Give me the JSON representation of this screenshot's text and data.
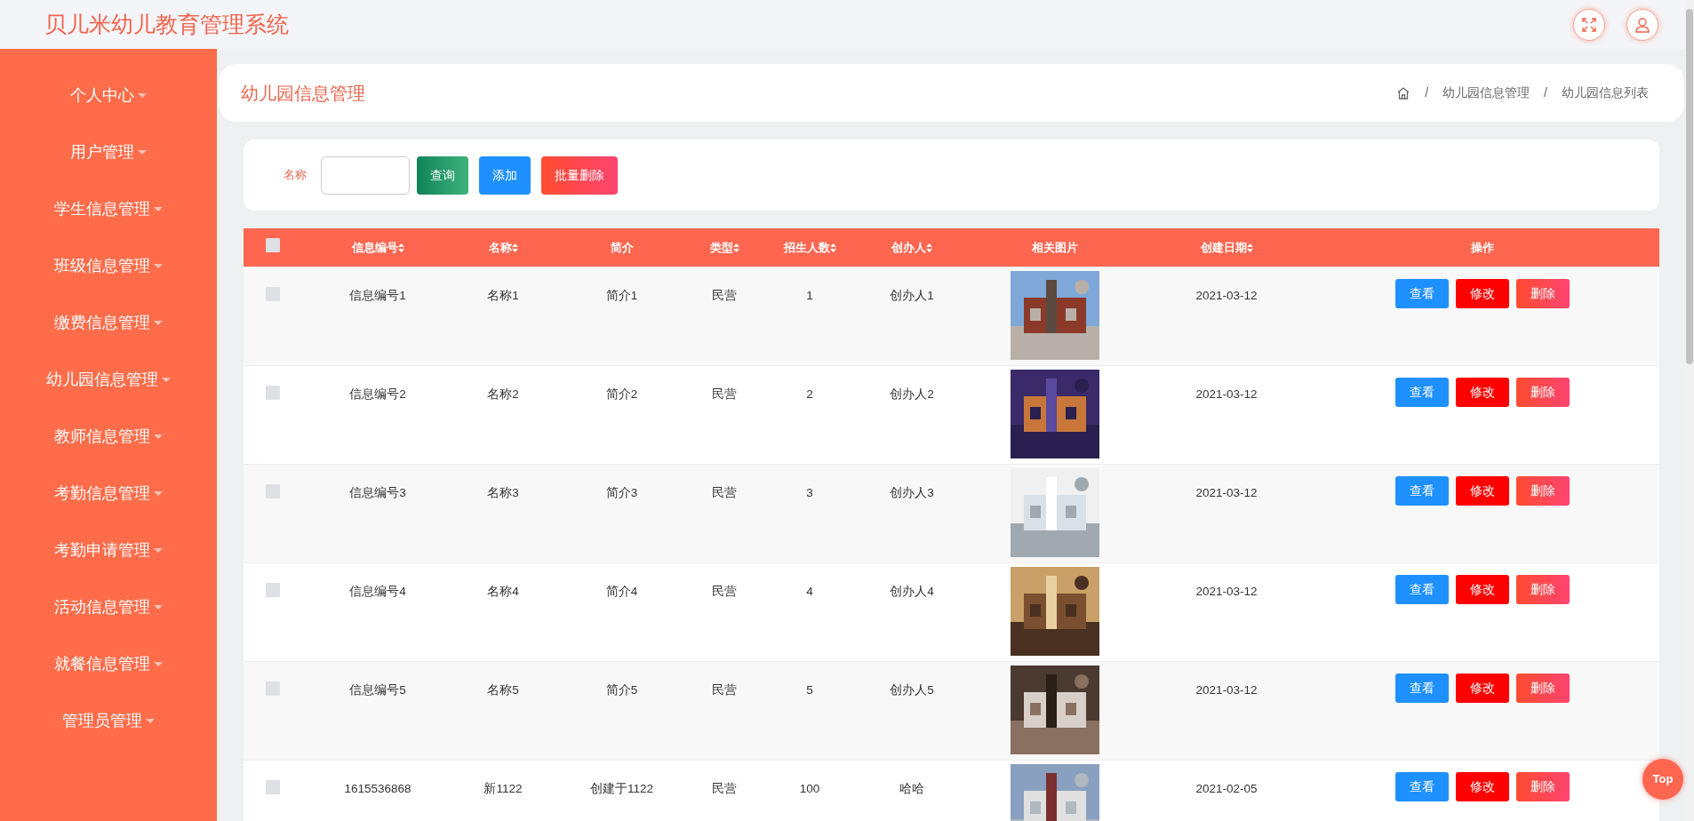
{
  "header": {
    "title": "贝儿米幼儿教育管理系统"
  },
  "sidebar": {
    "items": [
      "个人中心",
      "用户管理",
      "学生信息管理",
      "班级信息管理",
      "缴费信息管理",
      "幼儿园信息管理",
      "教师信息管理",
      "考勤信息管理",
      "考勤申请管理",
      "活动信息管理",
      "就餐信息管理",
      "管理员管理"
    ]
  },
  "page_title": "幼儿园信息管理",
  "breadcrumb": [
    {
      "separator": "/",
      "label": "幼儿园信息管理"
    },
    {
      "separator": "/",
      "label": "幼儿园信息列表"
    }
  ],
  "search": {
    "label": "名称",
    "buttons": [
      {
        "label": "查询",
        "kind": "search"
      },
      {
        "label": "添加",
        "kind": "add"
      },
      {
        "label": "批量删除",
        "kind": "delete"
      }
    ]
  },
  "table": {
    "select_all_checked": false,
    "columns": [
      {
        "label": "信息编号",
        "sortable": true
      },
      {
        "label": "名称",
        "sortable": true
      },
      {
        "label": "简介",
        "sortable": false
      },
      {
        "label": "类型",
        "sortable": true
      },
      {
        "label": "招生人数",
        "sortable": true
      },
      {
        "label": "创办人",
        "sortable": true
      },
      {
        "label": "相关图片",
        "sortable": false
      },
      {
        "label": "创建日期",
        "sortable": true
      },
      {
        "label": "操作",
        "sortable": false
      }
    ],
    "rows": [
      {
        "checked": false,
        "cells": [
          "信息编号1",
          "名称1",
          "简介1",
          "民营",
          "1",
          "创办人1"
        ],
        "date": "2021-03-12",
        "actions": [
          "查看",
          "修改",
          "删除"
        ]
      },
      {
        "checked": false,
        "cells": [
          "信息编号2",
          "名称2",
          "简介2",
          "民营",
          "2",
          "创办人2"
        ],
        "date": "2021-03-12",
        "actions": [
          "查看",
          "修改",
          "删除"
        ]
      },
      {
        "checked": false,
        "cells": [
          "信息编号3",
          "名称3",
          "简介3",
          "民营",
          "3",
          "创办人3"
        ],
        "date": "2021-03-12",
        "actions": [
          "查看",
          "修改",
          "删除"
        ]
      },
      {
        "checked": false,
        "cells": [
          "信息编号4",
          "名称4",
          "简介4",
          "民营",
          "4",
          "创办人4"
        ],
        "date": "2021-03-12",
        "actions": [
          "查看",
          "修改",
          "删除"
        ]
      },
      {
        "checked": false,
        "cells": [
          "信息编号5",
          "名称5",
          "简介5",
          "民营",
          "5",
          "创办人5"
        ],
        "date": "2021-03-12",
        "actions": [
          "查看",
          "修改",
          "删除"
        ]
      },
      {
        "checked": false,
        "cells": [
          "1615536868",
          "新1122",
          "创建于1122",
          "民营",
          "100",
          "哈哈"
        ],
        "date": "2021-02-05",
        "actions": [
          "查看",
          "修改",
          "删除"
        ]
      }
    ]
  },
  "back_to_top": "Top"
}
